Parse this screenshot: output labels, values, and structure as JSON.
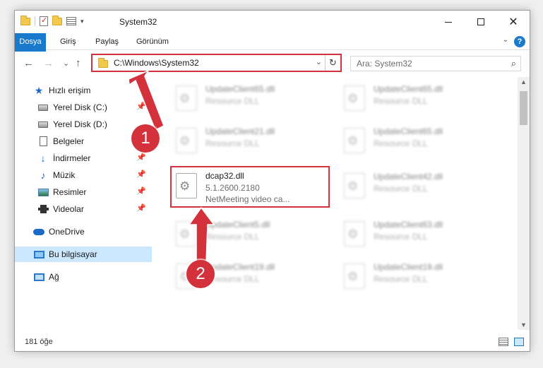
{
  "window": {
    "title": "System32",
    "minimize": "—",
    "close": "✕"
  },
  "ribbon": {
    "tabs": [
      "Dosya",
      "Giriş",
      "Paylaş",
      "Görünüm"
    ],
    "help": "?"
  },
  "nav": {
    "back": "←",
    "forward": "→",
    "recent": "⌄",
    "up": "↑",
    "path": "C:\\Windows\\System32",
    "search_placeholder": "Ara: System32"
  },
  "sidebar": {
    "items": [
      {
        "label": "Hızlı erişim",
        "icon": "star-icon"
      },
      {
        "label": "Yerel Disk (C:)",
        "icon": "disk-icon",
        "pinned": true
      },
      {
        "label": "Yerel Disk (D:)",
        "icon": "disk-icon",
        "pinned": false
      },
      {
        "label": "Belgeler",
        "icon": "document-icon",
        "pinned": true
      },
      {
        "label": "İndirmeler",
        "icon": "download-icon",
        "pinned": true
      },
      {
        "label": "Müzik",
        "icon": "music-icon",
        "pinned": true
      },
      {
        "label": "Resimler",
        "icon": "pictures-icon",
        "pinned": true
      },
      {
        "label": "Videolar",
        "icon": "videos-icon",
        "pinned": true
      },
      {
        "label": "OneDrive",
        "icon": "cloud-icon"
      },
      {
        "label": "Bu bilgisayar",
        "icon": "computer-icon",
        "selected": true
      },
      {
        "label": "Ağ",
        "icon": "network-icon"
      }
    ]
  },
  "files": {
    "left": [
      {
        "name": "UpdateClient65.dll",
        "type": "Resource DLL"
      },
      {
        "name": "UpdateClient21.dll",
        "type": "Resource DLL"
      },
      {
        "name": "UpdateClient5.dll",
        "type": "Resource DLL"
      },
      {
        "name": "UpdateClient19.dll",
        "type": "Resource DLL"
      }
    ],
    "right": [
      {
        "name": "UpdateClient65.dll",
        "type": "Resource DLL"
      },
      {
        "name": "UpdateClient65.dll",
        "type": "Resource DLL"
      },
      {
        "name": "UpdateClient42.dll",
        "type": "Resource DLL"
      },
      {
        "name": "UpdateClient63.dll",
        "type": "Resource DLL"
      },
      {
        "name": "UpdateClient19.dll",
        "type": "Resource DLL"
      }
    ],
    "highlighted": {
      "name": "dcap32.dll",
      "version": "5.1.2600.2180",
      "description": "NetMeeting video ca..."
    }
  },
  "status": {
    "count": "181 öğe"
  },
  "annotations": {
    "step1": "1",
    "step2": "2",
    "color": "#d3313b"
  }
}
